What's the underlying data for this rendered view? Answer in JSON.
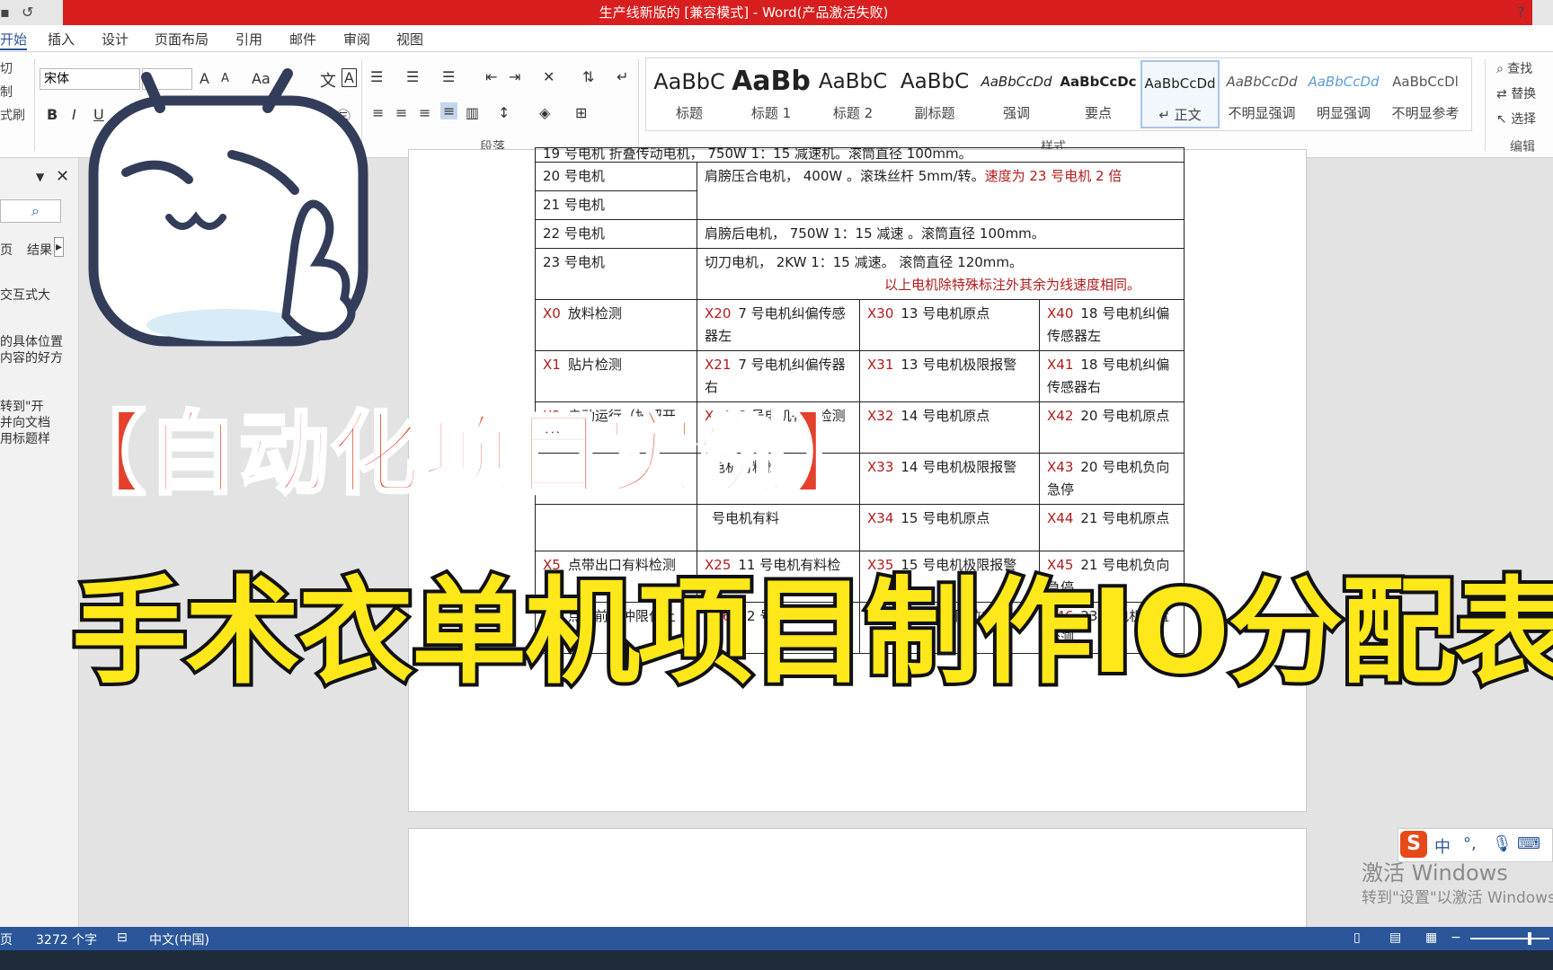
{
  "window": {
    "title": "生产线新版的 [兼容模式] - Word(产品激活失败)",
    "help": "?"
  },
  "tabs": [
    "开始",
    "插入",
    "设计",
    "页面布局",
    "引用",
    "邮件",
    "审阅",
    "视图"
  ],
  "ribbon": {
    "clipboard": [
      "切",
      "制",
      "式刷"
    ],
    "font_name": "宋体",
    "paragraph_group": "段落",
    "styles_group": "样式",
    "editing_group": "编辑",
    "styles": [
      {
        "sample": "AaBbC",
        "name": "标题"
      },
      {
        "sample": "AaBb",
        "name": "标题 1"
      },
      {
        "sample": "AaBbC",
        "name": "标题 2"
      },
      {
        "sample": "AaBbC",
        "name": "副标题"
      },
      {
        "sample": "AaBbCcDd",
        "name": "强调"
      },
      {
        "sample": "AaBbCcDc",
        "name": "要点"
      },
      {
        "sample": "AaBbCcDd",
        "name": "↵ 正文"
      },
      {
        "sample": "AaBbCcDd",
        "name": "不明显强调"
      },
      {
        "sample": "AaBbCcDd",
        "name": "明显强调"
      },
      {
        "sample": "AaBbCcDl",
        "name": "不明显参考"
      }
    ],
    "editing": [
      "查找",
      "替换",
      "选择"
    ]
  },
  "nav": {
    "tabs": [
      "页",
      "结果"
    ],
    "lines": [
      "交互式大",
      "的具体位置",
      "内容的好方",
      "转到\"开",
      "并向文档",
      "用标题样"
    ]
  },
  "table": {
    "row19": "19 号电机          折叠传动电机，    750W    1：15 减速机。滚筒直径 100mm。",
    "row20_label": "20 号电机",
    "row21_label": "21 号电机",
    "row20_desc": "肩膀压合电机，    400W   。滚珠丝杆 5mm/转。",
    "row20_red": "速度为 23 号电机 2 倍",
    "row22_label": "22 号电机",
    "row22_desc": "肩膀后电机，      750W    1：15 减速    。滚筒直径 100mm。",
    "row23_label": "23 号电机",
    "row23_desc": "切刀电机，        2KW    1：15 减速。     滚筒直径 120mm。",
    "note": "以上电机除特殊标注外其余为线速度相同。",
    "io_rows": [
      [
        {
          "code": "X0",
          "text": "放料检测"
        },
        {
          "code": "X20",
          "text": "7 号电机纠偏传感器左"
        },
        {
          "code": "X30",
          "text": "13 号电机原点"
        },
        {
          "code": "X40",
          "text": "18 号电机纠偏传感器左"
        }
      ],
      [
        {
          "code": "X1",
          "text": "贴片检测"
        },
        {
          "code": "X21",
          "text": "7 号电机纠偏传器右"
        },
        {
          "code": "X31",
          "text": "13 号电机极限报警"
        },
        {
          "code": "X41",
          "text": "18 号电机纠偏传感器右"
        }
      ],
      [
        {
          "code": "X2",
          "text": "启动运行（按钮开关）"
        },
        {
          "code": "X22",
          "text": "8 号电机有料检测"
        },
        {
          "code": "X32",
          "text": "14 号电机原点"
        },
        {
          "code": "X42",
          "text": "20 号电机原点"
        }
      ],
      [
        {
          "code": "",
          "text": ""
        },
        {
          "code": "",
          "text": "电机有料检"
        },
        {
          "code": "X33",
          "text": "14 号电机极限报警"
        },
        {
          "code": "X43",
          "text": "20 号电机负向急停"
        }
      ],
      [
        {
          "code": "",
          "text": ""
        },
        {
          "code": "",
          "text": "号电机有料"
        },
        {
          "code": "X34",
          "text": "15 号电机原点"
        },
        {
          "code": "X44",
          "text": "21 号电机原点"
        }
      ],
      [
        {
          "code": "X5",
          "text": "点带出口有料检测"
        },
        {
          "code": "X25",
          "text": "11 号电机有料检测"
        },
        {
          "code": "X35",
          "text": "15 号电机极限报警"
        },
        {
          "code": "X45",
          "text": "21 号电机负向急停"
        }
      ],
      [
        {
          "code": "X6",
          "text": "点带前缓冲限位上"
        },
        {
          "code": "X26",
          "text": "12 号电机原点"
        },
        {
          "code": "X36",
          "text": "折叠缓冲限位左"
        },
        {
          "code": "X46",
          "text": "23 号电机位置检测"
        }
      ]
    ]
  },
  "overlay": {
    "line1": "【自动化项目实例】",
    "line2": "手术衣单机项目制作IO分配表"
  },
  "watermark": {
    "line1": "激活 Windows",
    "line2": "转到\"设置\"以激活 Windows"
  },
  "ime": "中",
  "status": {
    "page": "页",
    "words": "3272 个字",
    "lang": "中文(中国)"
  }
}
